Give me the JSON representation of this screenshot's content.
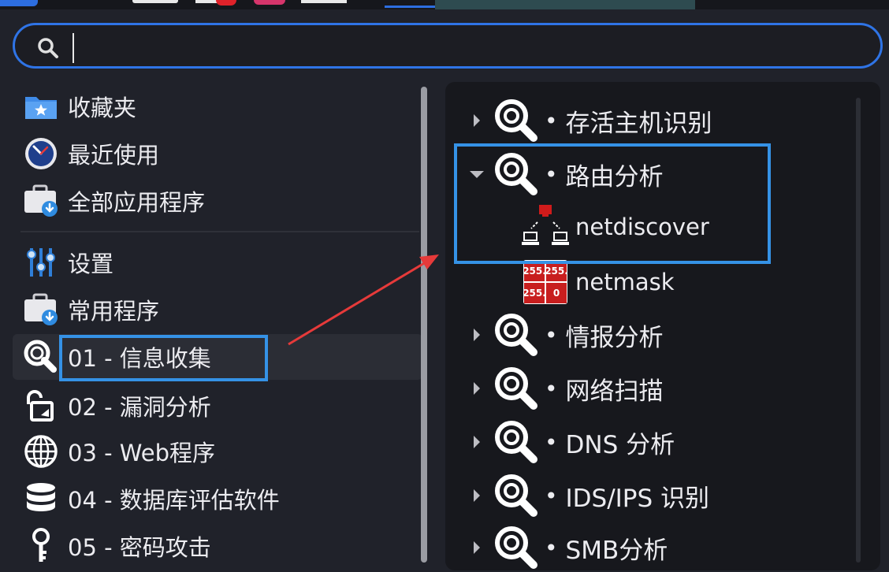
{
  "search": {
    "value": "",
    "placeholder": ""
  },
  "left_menu": [
    {
      "label": "收藏夹",
      "icon": "folder-star-icon"
    },
    {
      "label": "最近使用",
      "icon": "clock-icon"
    },
    {
      "label": "全部应用程序",
      "icon": "briefcase-download-icon"
    },
    {
      "label": "设置",
      "icon": "sliders-icon"
    },
    {
      "label": "常用程序",
      "icon": "briefcase-download-icon"
    },
    {
      "label": "01 - 信息收集",
      "icon": "magnifier-icon",
      "selected": true
    },
    {
      "label": "02 - 漏洞分析",
      "icon": "unlock-icon"
    },
    {
      "label": "03 - Web程序",
      "icon": "globe-icon"
    },
    {
      "label": "04 - 数据库评估软件",
      "icon": "database-icon"
    },
    {
      "label": "05 - 密码攻击",
      "icon": "key-icon"
    }
  ],
  "right_tree": [
    {
      "label": "存活主机识别",
      "expanded": false
    },
    {
      "label": "路由分析",
      "expanded": true
    },
    {
      "label": "情报分析",
      "expanded": false
    },
    {
      "label": "网络扫描",
      "expanded": false
    },
    {
      "label": "DNS 分析",
      "expanded": false
    },
    {
      "label": "IDS/IPS 识别",
      "expanded": false
    },
    {
      "label": "SMB分析",
      "expanded": false
    }
  ],
  "bullet": "•",
  "apps": [
    {
      "label": "netdiscover",
      "icon": "network-computers-icon"
    },
    {
      "label": "netmask",
      "icon": "netmask-icon"
    }
  ],
  "netmask_icon_text": {
    "tl": "255.",
    "tr": "255.",
    "bl": "255.",
    "br": "0"
  },
  "colors": {
    "accent": "#2f74e6",
    "highlight_box": "#3592e6",
    "annotation_arrow": "#e63a3a",
    "background": "#20222a",
    "panel": "#17181d"
  }
}
